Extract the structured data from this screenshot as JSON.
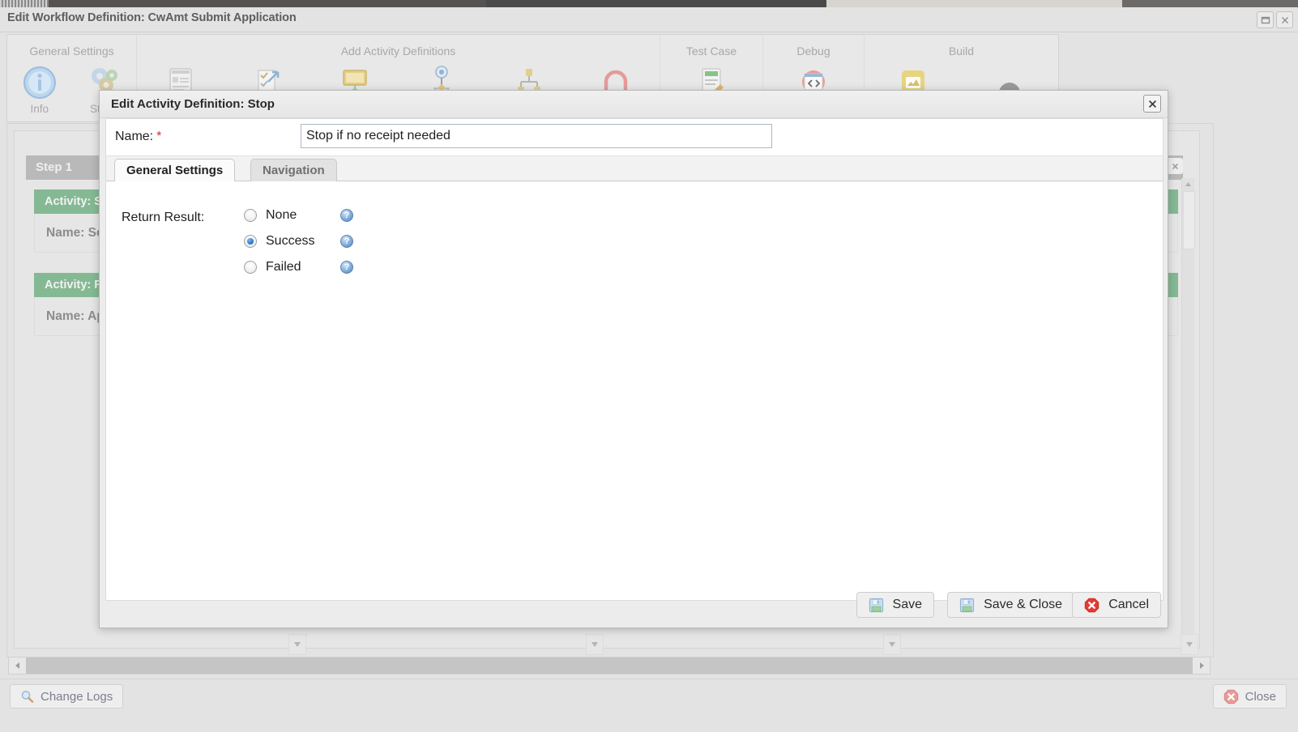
{
  "window": {
    "title": "Edit Workflow Definition: CwAmt Submit Application",
    "restore_icon": "restore-icon",
    "close_icon": "close-icon"
  },
  "ribbon": {
    "groups": [
      {
        "title": "General Settings",
        "items": [
          {
            "label": "Info",
            "icon": "info-icon"
          },
          {
            "label": "Steps",
            "icon": "gears-icon"
          }
        ]
      },
      {
        "title": "Add Activity Definitions",
        "items": [
          {
            "label": "",
            "icon": "form-icon"
          },
          {
            "label": "",
            "icon": "checklist-arrow-icon"
          },
          {
            "label": "",
            "icon": "screen-icon"
          },
          {
            "label": "",
            "icon": "process-node-icon"
          },
          {
            "label": "",
            "icon": "branch-icon"
          },
          {
            "label": "",
            "icon": "stop-arch-icon"
          }
        ]
      },
      {
        "title": "Test Case",
        "items": [
          {
            "label": "",
            "icon": "test-document-icon"
          }
        ]
      },
      {
        "title": "Debug",
        "items": [
          {
            "label": "",
            "icon": "code-debug-icon"
          }
        ]
      },
      {
        "title": "Build",
        "items": [
          {
            "label": "",
            "icon": "build-package-icon"
          },
          {
            "label": "",
            "icon": "deploy-icon"
          }
        ]
      }
    ]
  },
  "workspace": {
    "step_header": "Step 1",
    "activities": [
      {
        "header": "Activity: S",
        "name": "Name: Se"
      },
      {
        "header": "Activity: F",
        "name": "Name: Ap"
      }
    ],
    "panel_buttons": [
      {
        "icon": "minimize-icon"
      },
      {
        "icon": "close-icon"
      }
    ]
  },
  "dialog": {
    "title": "Edit Activity Definition: Stop",
    "close_icon": "close-icon",
    "name_label": "Name:",
    "required_marker": "*",
    "name_value": "Stop if no receipt needed",
    "name_placeholder": "",
    "tabs": [
      {
        "label": "General Settings",
        "active": true
      },
      {
        "label": "Navigation",
        "active": false
      }
    ],
    "return_result_label": "Return Result:",
    "return_result_options": [
      {
        "label": "None",
        "checked": false,
        "help_icon": "help-icon"
      },
      {
        "label": "Success",
        "checked": true,
        "help_icon": "help-icon"
      },
      {
        "label": "Failed",
        "checked": false,
        "help_icon": "help-icon"
      }
    ],
    "buttons": [
      {
        "label": "Save",
        "icon": "save-disk-icon"
      },
      {
        "label": "Save & Close",
        "icon": "save-disk-icon"
      },
      {
        "label": "Cancel",
        "icon": "cancel-x-icon"
      }
    ]
  },
  "bottom_bar": {
    "change_logs_label": "Change Logs",
    "change_logs_icon": "magnifier-icon",
    "close_label": "Close",
    "close_icon": "cancel-x-icon"
  },
  "colors": {
    "activity_green": "#85b994",
    "accent_blue": "#1a73c8",
    "required_red": "#d92d20",
    "window_chrome": "#e3e3e3"
  }
}
